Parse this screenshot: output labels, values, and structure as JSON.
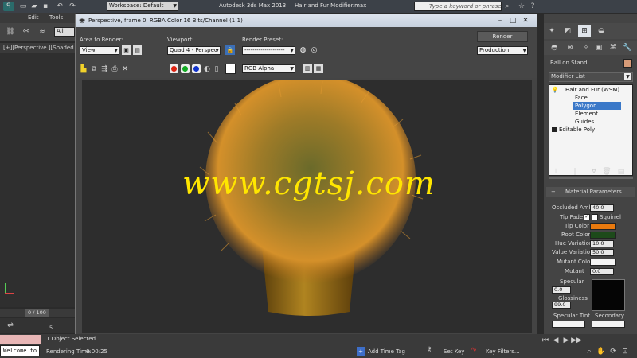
{
  "app": {
    "title": "Autodesk 3ds Max 2013",
    "file_name": "Hair and Fur Modifier.max",
    "workspace": "Workspace: Default",
    "search_placeholder": "Type a keyword or phrase",
    "menu": [
      "Edit",
      "Tools"
    ],
    "selection_filter": "All"
  },
  "viewport_label": "[+][Perspective ][Shaded ]",
  "render_window": {
    "title": "Perspective, frame 0, RGBA Color 16 Bits/Channel (1:1)",
    "area_label": "Area to Render:",
    "area_value": "View",
    "viewport_label": "Viewport:",
    "viewport_value": "Quad 4 - Perspec",
    "preset_label": "Render Preset:",
    "preset_value": "--------------------",
    "render_button": "Render",
    "mode_value": "Production",
    "channel_value": "RGB Alpha",
    "watermark": "www.cgtsj.com"
  },
  "command_panel": {
    "object_name": "Ball on Stand",
    "modifier_list": "Modifier List",
    "stack": [
      "Hair and Fur (WSM)",
      "Face",
      "Polygon",
      "Element",
      "Guides",
      "Editable Poly"
    ],
    "selected_item": "Polygon",
    "rollout_title": "Material Parameters",
    "occluded_label": "Occluded Amb.",
    "occluded_value": "40.0",
    "tip_fade_label": "Tip Fade",
    "squirrel_label": "Squirrel",
    "tip_color_label": "Tip Color",
    "root_color_label": "Root Color",
    "hue_label": "Hue Variation",
    "hue_value": "10.0",
    "value_var_label": "Value Variation",
    "value_var_value": "50.0",
    "mutant_color_label": "Mutant Color",
    "mutant_label": "Mutant",
    "mutant_value": "0.0",
    "specular_label": "Specular",
    "specular_value": "0.0",
    "glossiness_label": "Glossiness",
    "glossiness_value": "99.0",
    "specular_tint_label": "Specular Tint",
    "secondary_label": "Secondary"
  },
  "status": {
    "timeline": "0 / 100",
    "timeline_tick": "5",
    "objects_selected": "1 Object Selected",
    "rendering_time_label": "Rendering Time",
    "rendering_time_value": "0:00:25",
    "welcome": "Welcome to",
    "add_time_tag": "Add Time Tag",
    "set_key": "Set Key",
    "key_filters": "Key Filters..."
  },
  "colors": {
    "tip_color": "#e8790e",
    "root_color": "#1d4a1a",
    "mutant_color": "#f4f4f4",
    "specular_tint": "#f4f4f4",
    "fur": "#c98a1e",
    "pot": "#a87a1a"
  }
}
